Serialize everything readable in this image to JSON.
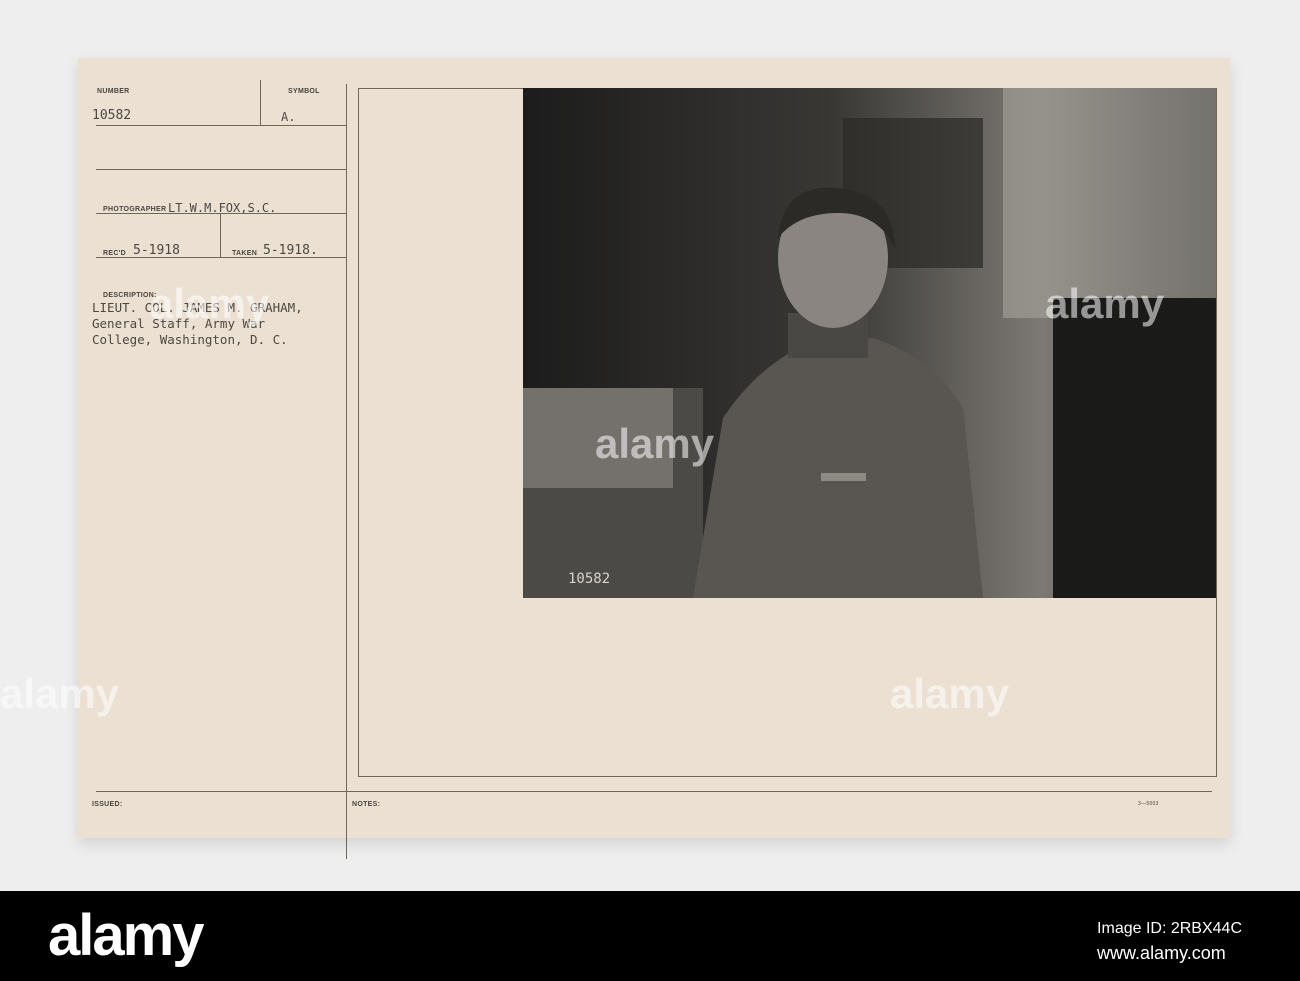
{
  "card": {
    "number_label": "NUMBER",
    "number": "10582",
    "symbol_label": "SYMBOL",
    "symbol": "A.",
    "photographer_label": "PHOTOGRAPHER",
    "photographer": "LT.W.M.FOX,S.C.",
    "recd_label": "REC'D",
    "recd": "5-1918",
    "taken_label": "TAKEN",
    "taken": "5-1918.",
    "description_label": "DESCRIPTION:",
    "description_lines": [
      "LIEUT. COL. JAMES M. GRAHAM,",
      "General Staff, Army War",
      "College, Washington, D. C."
    ],
    "issued_label": "ISSUED:",
    "notes_label": "NOTES:",
    "form_code": "3—5003"
  },
  "photo": {
    "negative_number": "10582"
  },
  "watermark": {
    "text": "alamy",
    "small": "a"
  },
  "footer": {
    "logo": "alamy",
    "image_id": "Image ID: 2RBX44C",
    "url": "www.alamy.com"
  }
}
